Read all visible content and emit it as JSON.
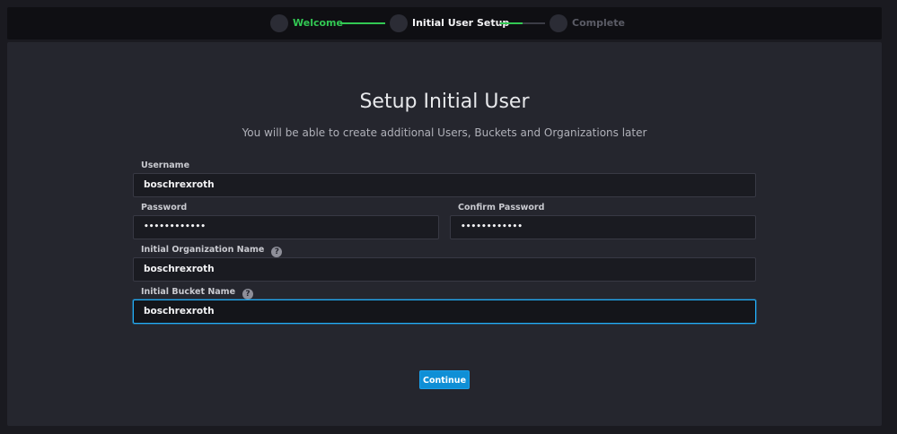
{
  "stepper": {
    "steps": [
      {
        "label": "Welcome",
        "state": "completed",
        "color": "#32c853"
      },
      {
        "label": "Initial User Setup",
        "state": "current",
        "color": "#f3f3f5"
      },
      {
        "label": "Complete",
        "state": "pending",
        "color": "#5b5c66"
      }
    ],
    "accent": "#32c853"
  },
  "page": {
    "title": "Setup Initial User",
    "subtitle": "You will be able to create additional Users, Buckets and Organizations later"
  },
  "form": {
    "username": {
      "label": "Username",
      "value": "boschrexroth"
    },
    "password": {
      "label": "Password",
      "value": "••••••••••••"
    },
    "confirm_password": {
      "label": "Confirm Password",
      "value": "••••••••••••"
    },
    "org": {
      "label": "Initial Organization Name",
      "value": "boschrexroth",
      "help_icon": "question-icon"
    },
    "bucket": {
      "label": "Initial Bucket Name",
      "value": "boschrexroth",
      "help_icon": "question-icon"
    },
    "help_glyph": "?"
  },
  "actions": {
    "continue_label": "Continue"
  }
}
